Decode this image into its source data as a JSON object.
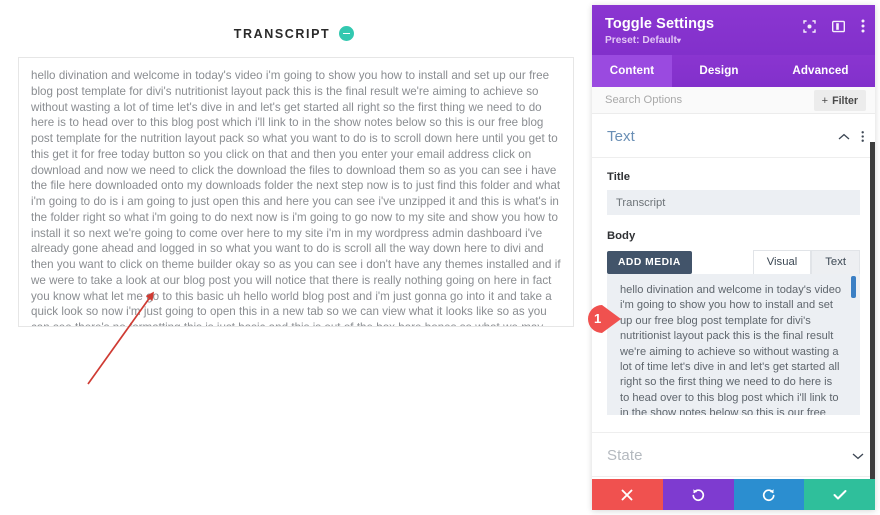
{
  "transcript": {
    "title": "TRANSCRIPT",
    "collapse_icon": "minus-circle-icon",
    "collapse_color": "#33c8b0",
    "body": "hello divination and welcome in today's video i'm going to show you how to install and set up our free blog post template for divi's nutritionist layout pack this is the final result we're aiming to achieve so without wasting a lot of time let's dive in and let's get started all right so the first thing we need to do here is to head over to this blog post which i'll link to in the show notes below so this is our free blog post template for the nutrition layout pack so what you want to do is to scroll down here until you get to this get it for free today button so you click on that and then you enter your email address click on download and now we need to click the download the files to download them so as you can see i have the file here downloaded onto my downloads folder the next step now is to just find this folder and what i'm going to do is i am going to just open this and here you can see i've unzipped it and this is what's in the folder right so what i'm going to do next now is i'm going to go now to my site and show you how to install it so next we're going to come over here to my site i'm in my wordpress admin dashboard i've already gone ahead and logged in so what you want to do is scroll all the way down here to divi and then you want to click on theme builder okay so as you can see i don't have any themes installed and if we were to take a look at our blog post you will notice that there is really nothing going on here in fact you know what let me go to this basic uh hello world blog post and i'm just gonna go into it and take a quick look so now i'm just going to open this in a new tab so we can view what it looks like so as you can see there's no formatting this is just basic and this is out of the box bare bones so what we may need to do here is to go in and add a featured image so i'm going to click here on edit"
  },
  "annotation": {
    "marker_number": "1",
    "marker_color": "#f0514f",
    "arrow_color": "#cf3b33"
  },
  "panel": {
    "header": {
      "title": "Toggle Settings",
      "preset": "Preset: Default",
      "preset_caret": "▾",
      "icons": [
        "target-focus-icon",
        "panel-layout-icon",
        "more-vertical-icon"
      ],
      "background_color": "#8b36d1"
    },
    "tabs": [
      {
        "label": "Content",
        "active": true
      },
      {
        "label": "Design",
        "active": false
      },
      {
        "label": "Advanced",
        "active": false
      }
    ],
    "search": {
      "placeholder": "Search Options",
      "value": ""
    },
    "filter": {
      "label": "Filter",
      "plus": "+",
      "icon": "plus-icon"
    },
    "sections": {
      "text": {
        "title": "Text",
        "collapse_icon": "chevron-up-icon",
        "more_icon": "more-vertical-icon",
        "title_field": {
          "label": "Title",
          "value": "Transcript"
        },
        "body_field": {
          "label": "Body",
          "add_media_label": "ADD MEDIA",
          "editor_tabs": [
            {
              "label": "Visual",
              "active": false
            },
            {
              "label": "Text",
              "active": true
            }
          ],
          "value": "hello divination and welcome in today's video i'm going to show you how to install and set up our free blog post template for divi's nutritionist layout pack this is the final result we're aiming to achieve so without wasting a lot of time let's dive in and let's get started all right so the first thing we need to do here is to head over to this blog post which i'll link to in the show notes below so this is our free blog post template for the nutrition layout"
        }
      },
      "state": {
        "title": "State",
        "collapse_icon": "chevron-down-icon"
      }
    },
    "footer_buttons": [
      {
        "name": "cancel",
        "icon": "close-x-icon",
        "color": "#f0514f"
      },
      {
        "name": "undo",
        "icon": "undo-arrow-icon",
        "color": "#7e3bd0"
      },
      {
        "name": "redo",
        "icon": "redo-arrow-icon",
        "color": "#2b8ed0"
      },
      {
        "name": "save",
        "icon": "check-icon",
        "color": "#2fbf9b"
      }
    ]
  }
}
